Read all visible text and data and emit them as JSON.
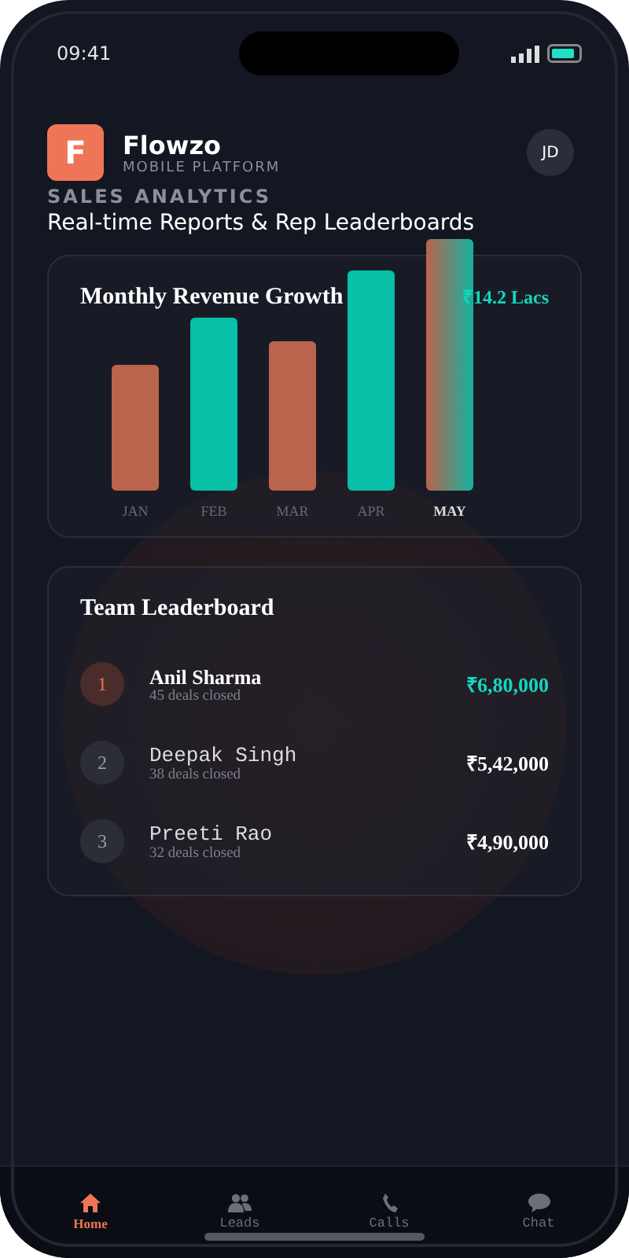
{
  "status_bar": {
    "time": "09:41"
  },
  "header": {
    "logo_letter": "F",
    "app_name": "Flowzo",
    "tagline": "MOBILE PLATFORM",
    "avatar": "JD"
  },
  "section": {
    "eyebrow": "SALES ANALYTICS",
    "title": "Real-time Reports & Rep Leaderboards"
  },
  "revenue_card": {
    "title": "Monthly Revenue Growth",
    "total": "₹14.2 Lacs",
    "months": [
      {
        "label": "JAN",
        "kind": "coral",
        "selected": false
      },
      {
        "label": "FEB",
        "kind": "teal",
        "selected": false
      },
      {
        "label": "MAR",
        "kind": "coral",
        "selected": false
      },
      {
        "label": "APR",
        "kind": "teal",
        "selected": false
      },
      {
        "label": "MAY",
        "kind": "blend",
        "selected": true
      }
    ]
  },
  "leaderboard": {
    "title": "Team Leaderboard",
    "reps": [
      {
        "rank": "1",
        "name": "Anil Sharma",
        "deals": "45 deals closed",
        "amount": "₹6,80,000",
        "selected": true
      },
      {
        "rank": "2",
        "name": "Deepak Singh",
        "deals": "38 deals closed",
        "amount": "₹5,42,000",
        "selected": false
      },
      {
        "rank": "3",
        "name": "Preeti Rao",
        "deals": "32 deals closed",
        "amount": "₹4,90,000",
        "selected": false
      }
    ]
  },
  "tab_bar": [
    {
      "label": "Home",
      "kind": "home",
      "selected": true
    },
    {
      "label": "Leads",
      "kind": "people",
      "selected": false
    },
    {
      "label": "Calls",
      "kind": "phone",
      "selected": false
    },
    {
      "label": "Chat",
      "kind": "chat",
      "selected": false
    }
  ]
}
